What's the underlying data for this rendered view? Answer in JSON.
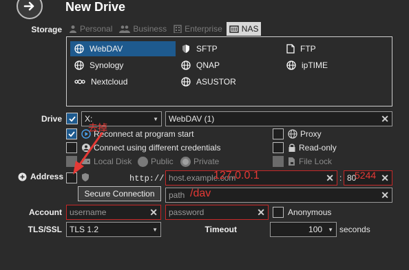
{
  "header": {
    "title": "New Drive"
  },
  "storage": {
    "label": "Storage",
    "tabs": [
      {
        "label": "Personal",
        "icon": "person-icon"
      },
      {
        "label": "Business",
        "icon": "people-icon"
      },
      {
        "label": "Enterprise",
        "icon": "building-icon"
      },
      {
        "label": "NAS",
        "icon": "nas-icon"
      }
    ],
    "protocols": [
      {
        "label": "WebDAV"
      },
      {
        "label": "SFTP"
      },
      {
        "label": "FTP"
      },
      {
        "label": "Synology"
      },
      {
        "label": "QNAP"
      },
      {
        "label": "ipTIME"
      },
      {
        "label": "Nextcloud"
      },
      {
        "label": "ASUSTOR"
      }
    ]
  },
  "drive": {
    "label": "Drive",
    "letter": "X:",
    "name": "WebDAV (1)"
  },
  "options": {
    "reconnect": "Reconnect at program start",
    "different_credentials": "Connect using different credentials",
    "local_disk": "Local Disk",
    "public": "Public",
    "private": "Private",
    "proxy": "Proxy",
    "read_only": "Read-only",
    "file_lock": "File Lock"
  },
  "address": {
    "label": "Address",
    "secure_connection": "Secure Connection",
    "scheme": "http://",
    "host_placeholder": "host.example.com",
    "port": "80",
    "path_placeholder": "path"
  },
  "account": {
    "label": "Account",
    "username_placeholder": "username",
    "password_placeholder": "password",
    "anonymous": "Anonymous"
  },
  "tls": {
    "label": "TLS/SSL",
    "value": "TLS 1.2"
  },
  "timeout": {
    "label": "Timeout",
    "value": "100",
    "unit": "seconds"
  },
  "annotations": {
    "remove": "去掉",
    "host": "127.0.0.1",
    "port": "5244",
    "path": "/dav"
  },
  "colors": {
    "accent": "#1e5a8e",
    "annotation": "#e53935"
  }
}
